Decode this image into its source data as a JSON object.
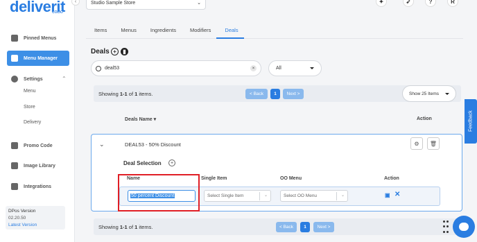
{
  "brand": {
    "logo": "deliverit",
    "logo_sub": "COLIO"
  },
  "sidebar": {
    "items": [
      {
        "label": "Pinned Menus",
        "icon": "pin-icon"
      },
      {
        "label": "Menu Manager",
        "icon": "menu-icon",
        "active": true
      },
      {
        "label": "Settings",
        "icon": "gear-icon"
      },
      {
        "label": "Promo Code",
        "icon": "promo-icon"
      },
      {
        "label": "Image Library",
        "icon": "image-icon"
      },
      {
        "label": "Integrations",
        "icon": "integrations-icon"
      }
    ],
    "settings_sub": [
      "Menu",
      "Store",
      "Delivery"
    ],
    "version": {
      "title": "DPos Version",
      "number": "02.20.50",
      "link": "Latest Version"
    }
  },
  "topbar": {
    "store": "Studio Sample Store",
    "avatar": "R"
  },
  "tabs": [
    {
      "label": "Items"
    },
    {
      "label": "Menus"
    },
    {
      "label": "Ingredients"
    },
    {
      "label": "Modifiers"
    },
    {
      "label": "Deals",
      "active": true
    }
  ],
  "deals": {
    "title": "Deals",
    "search_value": "deal53",
    "filter_value": "All",
    "pager_top": {
      "prefix": "Showing ",
      "range": "1-1",
      "of": " of ",
      "total": "1",
      "suffix": " items."
    },
    "pager_bottom": {
      "prefix": "Showing ",
      "range": "1-1",
      "of": " of ",
      "total": "1",
      "suffix": " items."
    },
    "back_label": "< Back",
    "page": "1",
    "next_label": "Next >",
    "per_page": "Show 25 Items",
    "col_name": "Deals Name",
    "col_action": "Action",
    "row": {
      "name": "DEAL53 - 50% Discount"
    },
    "selection": {
      "title": "Deal Selection",
      "headers": {
        "name": "Name",
        "single_item": "Single Item",
        "oo_menu": "OO Menu",
        "action": "Action"
      },
      "name_value": "50 percent Discount",
      "single_item_placeholder": "Select Single Item",
      "oo_menu_placeholder": "Select OO Menu"
    }
  },
  "feedback_label": "Feedback",
  "colors": {
    "accent": "#2a7de1",
    "highlight": "#e01e25"
  }
}
